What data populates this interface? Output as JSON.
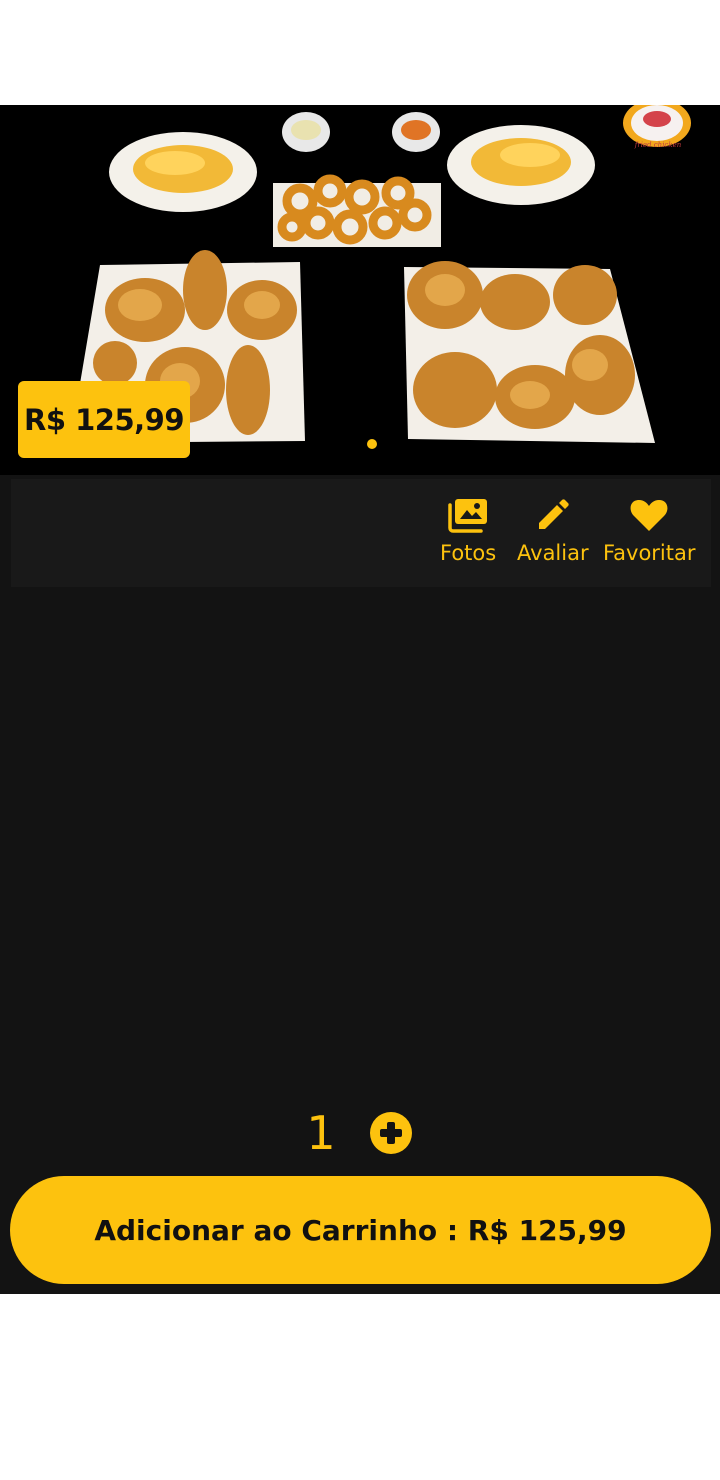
{
  "product": {
    "price_badge": "R$ 125,99",
    "image_icon": "fried-chicken-combo-photo",
    "brand_logo_text": "fried chicken"
  },
  "carousel": {
    "dots": 2,
    "active_index": 1
  },
  "actions": [
    {
      "label": "Fotos",
      "icon": "photos-icon"
    },
    {
      "label": "Avaliar",
      "icon": "pencil-icon"
    },
    {
      "label": "Favoritar",
      "icon": "heart-icon"
    }
  ],
  "quantity": {
    "value": "1"
  },
  "cart": {
    "label": "Adicionar ao Carrinho : R$ 125,99"
  },
  "colors": {
    "accent": "#fdc20e",
    "background": "#131313",
    "panel": "#191919"
  }
}
